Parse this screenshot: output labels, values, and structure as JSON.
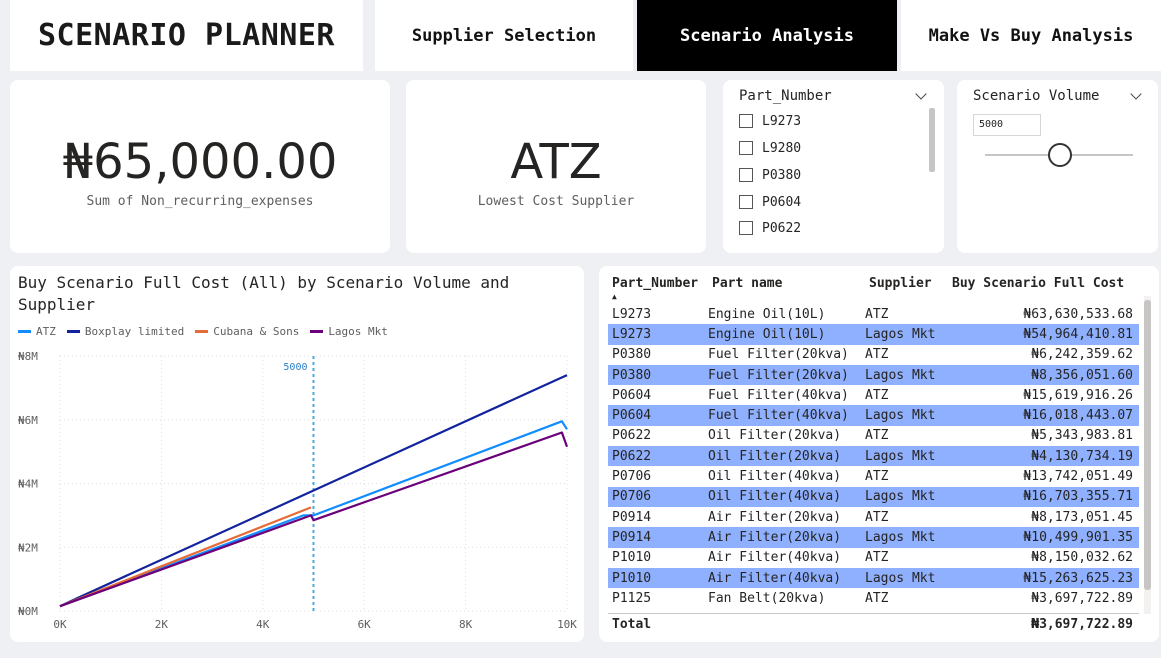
{
  "header": {
    "title": "SCENARIO PLANNER",
    "tabs": [
      {
        "label": "Supplier Selection",
        "active": false
      },
      {
        "label": "Scenario Analysis",
        "active": true
      },
      {
        "label": "Make Vs Buy Analysis",
        "active": false
      }
    ]
  },
  "kpis": {
    "non_recurring": {
      "value": "₦65,000.00",
      "label": "Sum of Non_recurring_expenses"
    },
    "lowest_supplier": {
      "value": "ATZ",
      "label": "Lowest Cost Supplier"
    }
  },
  "part_slicer": {
    "title": "Part_Number",
    "items": [
      "L9273",
      "L9280",
      "P0380",
      "P0604",
      "P0622"
    ]
  },
  "volume_slicer": {
    "title": "Scenario Volume",
    "value": "5000"
  },
  "line_chart": {
    "title": "Buy Scenario Full Cost (All) by Scenario Volume and Supplier",
    "reference_label": "5000"
  },
  "chart_data": {
    "type": "line",
    "title": "Buy Scenario Full Cost (All) by Scenario Volume and Supplier",
    "xlabel": "",
    "ylabel": "",
    "xlim": [
      0,
      10000
    ],
    "ylim": [
      0,
      8000000
    ],
    "x_ticks": [
      "0K",
      "2K",
      "4K",
      "6K",
      "8K",
      "10K"
    ],
    "y_ticks": [
      "₦0M",
      "₦2M",
      "₦4M",
      "₦6M",
      "₦8M"
    ],
    "grid": true,
    "legend_position": "top-left",
    "reference_line_x": 5000,
    "series": [
      {
        "name": "ATZ",
        "color": "#118dff",
        "points": [
          [
            0,
            150000
          ],
          [
            4800,
            3000000
          ],
          [
            5000,
            3000000
          ],
          [
            9900,
            5950000
          ],
          [
            10000,
            5700000
          ]
        ]
      },
      {
        "name": "Boxplay limited",
        "color": "#12239e",
        "points": [
          [
            0,
            150000
          ],
          [
            400,
            450000
          ],
          [
            10000,
            7400000
          ]
        ]
      },
      {
        "name": "Cubana & Sons",
        "color": "#e66c37",
        "points": [
          [
            0,
            150000
          ],
          [
            4950,
            3250000
          ]
        ]
      },
      {
        "name": "Lagos Mkt",
        "color": "#6b007b",
        "points": [
          [
            0,
            150000
          ],
          [
            4950,
            3000000
          ],
          [
            5000,
            2850000
          ],
          [
            9900,
            5600000
          ],
          [
            10000,
            5150000
          ]
        ]
      }
    ]
  },
  "table": {
    "headers": [
      "Part_Number",
      "Part name",
      "Supplier",
      "Buy Scenario Full Cost"
    ],
    "rows": [
      [
        "L9273",
        "Engine Oil(10L)",
        "ATZ",
        "₦63,630,533.68"
      ],
      [
        "L9273",
        "Engine Oil(10L)",
        "Lagos Mkt",
        "₦54,964,410.81"
      ],
      [
        "P0380",
        "Fuel Filter(20kva)",
        "ATZ",
        "₦6,242,359.62"
      ],
      [
        "P0380",
        "Fuel Filter(20kva)",
        "Lagos Mkt",
        "₦8,356,051.60"
      ],
      [
        "P0604",
        "Fuel Filter(40kva)",
        "ATZ",
        "₦15,619,916.26"
      ],
      [
        "P0604",
        "Fuel Filter(40kva)",
        "Lagos Mkt",
        "₦16,018,443.07"
      ],
      [
        "P0622",
        "Oil Filter(20kva)",
        "ATZ",
        "₦5,343,983.81"
      ],
      [
        "P0622",
        "Oil Filter(20kva)",
        "Lagos Mkt",
        "₦4,130,734.19"
      ],
      [
        "P0706",
        "Oil Filter(40kva)",
        "ATZ",
        "₦13,742,051.49"
      ],
      [
        "P0706",
        "Oil Filter(40kva)",
        "Lagos Mkt",
        "₦16,703,355.71"
      ],
      [
        "P0914",
        "Air Filter(20kva)",
        "ATZ",
        "₦8,173,051.45"
      ],
      [
        "P0914",
        "Air Filter(20kva)",
        "Lagos Mkt",
        "₦10,499,901.35"
      ],
      [
        "P1010",
        "Air Filter(40kva)",
        "ATZ",
        "₦8,150,032.62"
      ],
      [
        "P1010",
        "Air Filter(40kva)",
        "Lagos Mkt",
        "₦15,263,625.23"
      ],
      [
        "P1125",
        "Fan Belt(20kva)",
        "ATZ",
        "₦3,697,722.89"
      ]
    ],
    "total_label": "Total",
    "total_value": "₦3,697,722.89"
  }
}
